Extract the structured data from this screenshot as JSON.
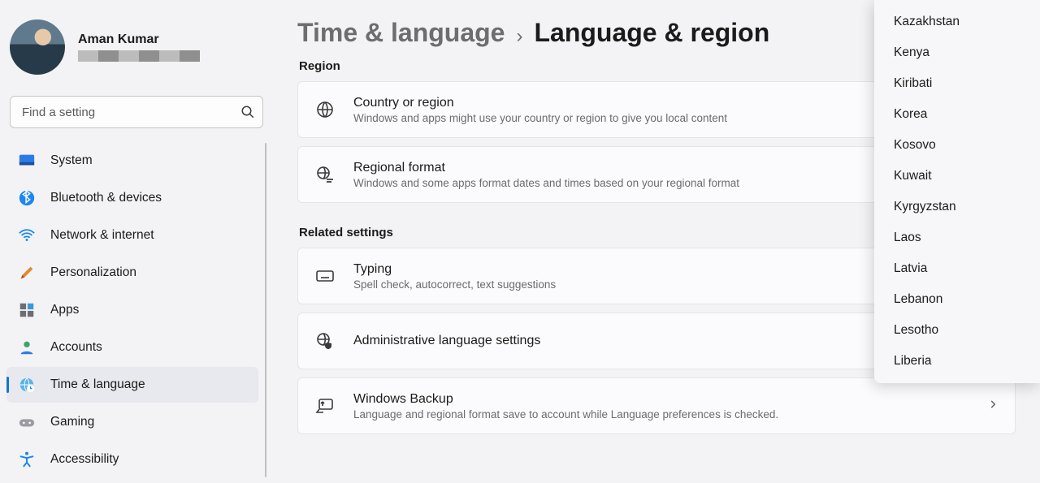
{
  "profile": {
    "name": "Aman Kumar"
  },
  "search": {
    "placeholder": "Find a setting"
  },
  "nav": {
    "items": [
      {
        "key": "system",
        "label": "System"
      },
      {
        "key": "bluetooth",
        "label": "Bluetooth & devices"
      },
      {
        "key": "network",
        "label": "Network & internet"
      },
      {
        "key": "personalization",
        "label": "Personalization"
      },
      {
        "key": "apps",
        "label": "Apps"
      },
      {
        "key": "accounts",
        "label": "Accounts"
      },
      {
        "key": "time-language",
        "label": "Time & language"
      },
      {
        "key": "gaming",
        "label": "Gaming"
      },
      {
        "key": "accessibility",
        "label": "Accessibility"
      }
    ]
  },
  "breadcrumb": {
    "parent": "Time & language",
    "page": "Language & region"
  },
  "region": {
    "header": "Region",
    "country": {
      "title": "Country or region",
      "sub": "Windows and apps might use your country or region to give you local content"
    },
    "format": {
      "title": "Regional format",
      "sub": "Windows and some apps format dates and times based on your regional format"
    }
  },
  "related": {
    "header": "Related settings",
    "typing": {
      "title": "Typing",
      "sub": "Spell check, autocorrect, text suggestions"
    },
    "admin": {
      "title": "Administrative language settings"
    },
    "backup": {
      "title": "Windows Backup",
      "sub": "Language and regional format save to account while Language preferences is checked."
    }
  },
  "dropdown": {
    "items": [
      "Kazakhstan",
      "Kenya",
      "Kiribati",
      "Korea",
      "Kosovo",
      "Kuwait",
      "Kyrgyzstan",
      "Laos",
      "Latvia",
      "Lebanon",
      "Lesotho",
      "Liberia"
    ]
  }
}
